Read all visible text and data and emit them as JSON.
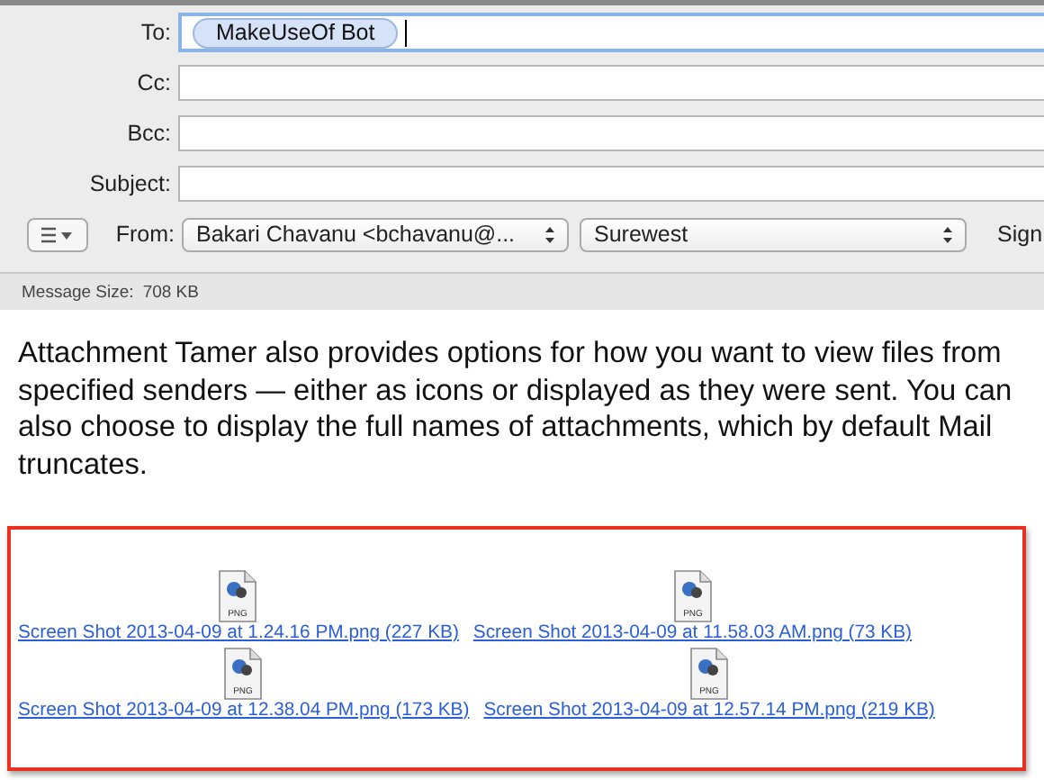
{
  "header": {
    "to": {
      "label": "To:",
      "recipients": [
        "MakeUseOf Bot"
      ]
    },
    "fields": [
      {
        "label": "Cc:"
      },
      {
        "label": "Bcc:"
      },
      {
        "label": "Subject:"
      }
    ],
    "from": {
      "label": "From:",
      "account": "Bakari Chavanu <bchavanu@...",
      "server": "Surewest",
      "signature_label": "Sign"
    },
    "message_size": {
      "label": "Message Size:",
      "value": "708 KB"
    }
  },
  "body": {
    "paragraph": "Attachment Tamer also provides options for how you want to view files from specified senders — either as icons or displayed as they were sent. You can also choose to display the full names of attachments, which by default Mail truncates.",
    "attachments": [
      {
        "icon_label": "PNG",
        "name": "Screen Shot 2013-04-09 at 1.24.16 PM.png (227 KB)"
      },
      {
        "icon_label": "PNG",
        "name": "Screen Shot 2013-04-09 at 11.58.03 AM.png (73 KB)"
      },
      {
        "icon_label": "PNG",
        "name": "Screen Shot 2013-04-09 at 12.38.04 PM.png (173 KB)"
      },
      {
        "icon_label": "PNG",
        "name": "Screen Shot 2013-04-09 at 12.57.14 PM.png (219 KB)"
      }
    ]
  }
}
